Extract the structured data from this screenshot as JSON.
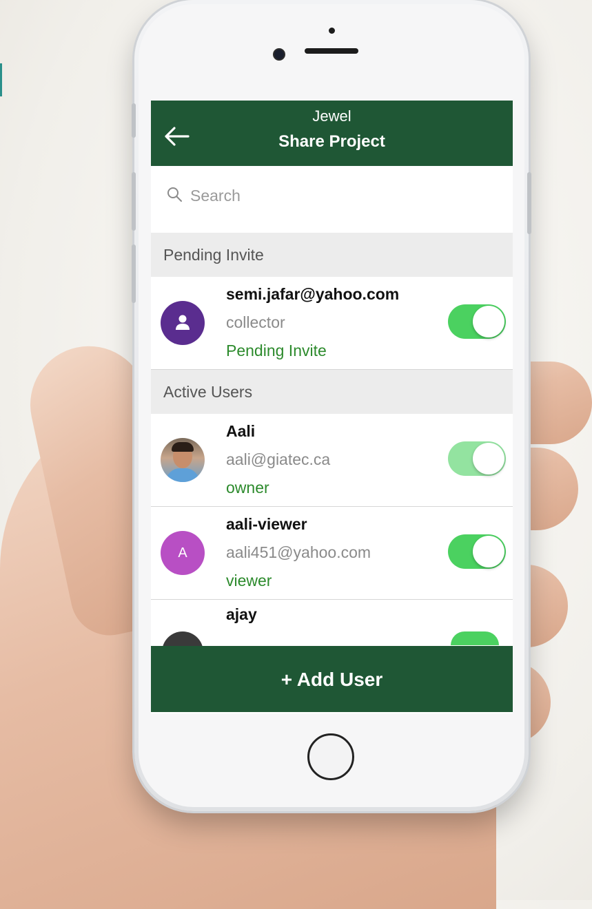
{
  "header": {
    "subtitle": "Jewel",
    "title": "Share Project"
  },
  "search": {
    "placeholder": "Search"
  },
  "sections": {
    "pending": "Pending Invite",
    "active": "Active Users"
  },
  "pending_invites": [
    {
      "name": "semi.jafar@yahoo.com",
      "detail": "collector",
      "status": "Pending Invite",
      "enabled": true
    }
  ],
  "active_users": [
    {
      "name": "Aali",
      "detail": "aali@giatec.ca",
      "role": "owner",
      "enabled": true,
      "avatar": "photo"
    },
    {
      "name": "aali-viewer",
      "detail": "aali451@yahoo.com",
      "role": "viewer",
      "enabled": true,
      "avatar_letter": "A"
    },
    {
      "name": "ajay"
    }
  ],
  "footer": {
    "add_user_label": "+ Add User"
  },
  "colors": {
    "brand": "#1f5735",
    "toggle_on": "#4bd160",
    "role_text": "#2c8a2c",
    "pending_avatar": "#5a2d8f",
    "viewer_avatar": "#b84fc4"
  }
}
